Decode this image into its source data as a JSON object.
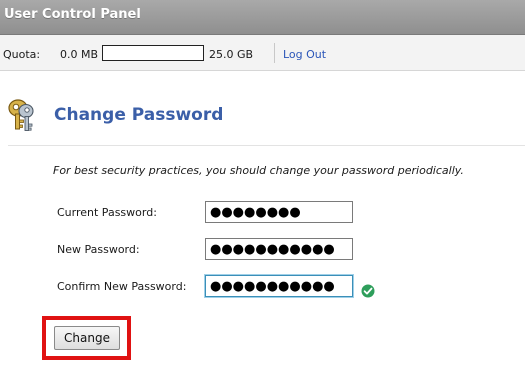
{
  "header": {
    "title": "User Control Panel"
  },
  "quota": {
    "label": "Quota:",
    "used": "0.0 MB",
    "total": "25.0 GB",
    "fill_fraction": 0.0,
    "logout_label": "Log Out"
  },
  "page": {
    "title": "Change Password",
    "icon": "keys-icon",
    "intro": "For best security practices, you should change your password periodically."
  },
  "form": {
    "current_label": "Current Password:",
    "current_value": "●●●●●●●●",
    "new_label": "New Password:",
    "new_value": "●●●●●●●●●●●",
    "confirm_label": "Confirm New Password:",
    "confirm_value": "●●●●●●●●●●●",
    "confirm_status_icon": "check-circle-icon",
    "submit_label": "Change"
  },
  "colors": {
    "title_blue": "#3b5fa8",
    "link_blue": "#2a55b8",
    "highlight_red": "#e01212",
    "check_green": "#2e9e5b"
  }
}
